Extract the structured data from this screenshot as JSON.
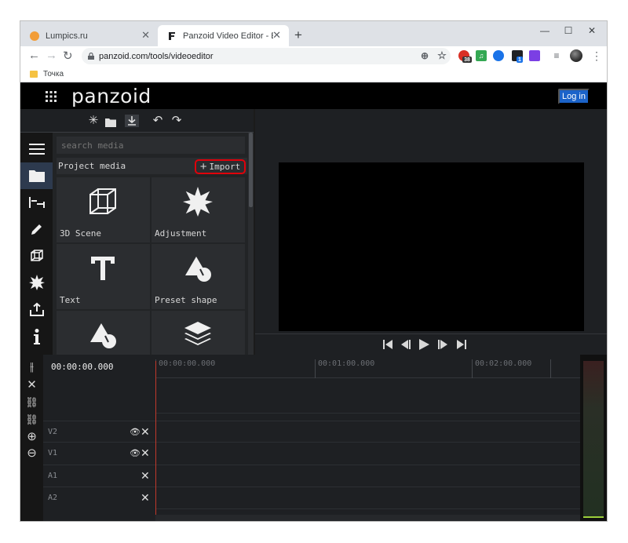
{
  "browser": {
    "tabs": [
      {
        "title": "Lumpics.ru",
        "active": false
      },
      {
        "title": "Panzoid Video Editor - Edit Video",
        "active": true
      }
    ],
    "address": "panzoid.com/tools/videoeditor",
    "bookmark": "Точка",
    "extension_badge": "38",
    "extension_badge2": "1"
  },
  "app": {
    "logo": "panzoid",
    "login_label": "Log in"
  },
  "media": {
    "search_placeholder": "search media",
    "title": "Project media",
    "import_label": "Import",
    "tiles": [
      {
        "label": "3D Scene",
        "icon": "cube-icon"
      },
      {
        "label": "Adjustment",
        "icon": "starburst-icon"
      },
      {
        "label": "Text",
        "icon": "text-t-icon"
      },
      {
        "label": "Preset shape",
        "icon": "shapes-icon"
      },
      {
        "label": "",
        "icon": "shapes-icon"
      },
      {
        "label": "",
        "icon": "layers-icon"
      }
    ]
  },
  "timeline": {
    "timecode": "00:00:00.000",
    "ruler": [
      "00:00:00.000",
      "00:01:00.000",
      "00:02:00.000"
    ],
    "tracks": [
      {
        "name": "V2",
        "has_eye": true
      },
      {
        "name": "V1",
        "has_eye": true
      },
      {
        "name": "A1",
        "has_eye": false
      },
      {
        "name": "A2",
        "has_eye": false
      }
    ]
  }
}
